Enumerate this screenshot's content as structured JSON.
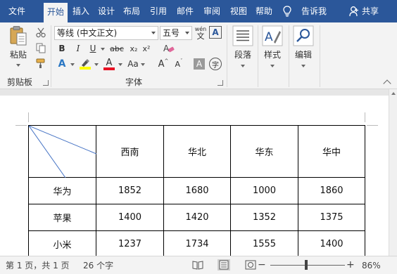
{
  "menu": {
    "tabs": [
      "文件",
      "开始",
      "插入",
      "设计",
      "布局",
      "引用",
      "邮件",
      "审阅",
      "视图",
      "帮助"
    ],
    "active_tab": "开始",
    "tell_me": "告诉我",
    "share": "共享"
  },
  "ribbon": {
    "clipboard": {
      "paste_label": "粘贴",
      "group_label": "剪贴板"
    },
    "font": {
      "font_name": "等线 (中文正文)",
      "font_size": "五号",
      "wen_label": "wén",
      "bold": "B",
      "italic": "I",
      "underline": "U",
      "strike": "abc",
      "subscript": "x₂",
      "superscript": "x²",
      "grow": "A",
      "shrink": "A",
      "change_case": "Aa",
      "char_shade": "A",
      "enclose": "字",
      "group_label": "字体"
    },
    "paragraph": {
      "label": "段落"
    },
    "styles": {
      "label": "样式"
    },
    "editing": {
      "label": "编辑"
    },
    "colors": {
      "brand": "#2b579a",
      "highlight": "#ffff00",
      "font_color": "#e81123"
    }
  },
  "table": {
    "headers": [
      "西南",
      "华北",
      "华东",
      "华中"
    ],
    "rows": [
      [
        "华为",
        "1852",
        "1680",
        "1000",
        "1860"
      ],
      [
        "苹果",
        "1400",
        "1420",
        "1352",
        "1375"
      ],
      [
        "小米",
        "1237",
        "1734",
        "1555",
        "1400"
      ]
    ]
  },
  "status": {
    "page": "第 1 页，共 1 页",
    "words": "26 个字",
    "zoom_minus": "−",
    "zoom_plus": "+",
    "zoom": "86%"
  }
}
